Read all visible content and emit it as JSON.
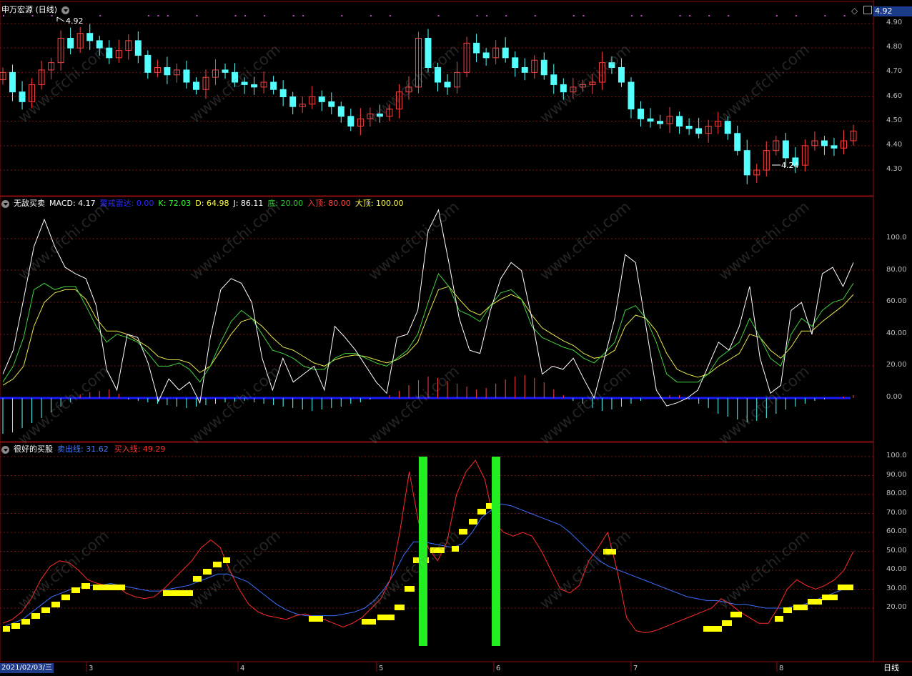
{
  "panel1": {
    "title": "申万宏源 (日线)",
    "price_box": "4.92",
    "high_marker": "4.92",
    "low_marker": "4.24",
    "axis": [
      "4.90",
      "4.80",
      "4.70",
      "4.60",
      "4.50",
      "4.40",
      "4.30"
    ]
  },
  "panel2": {
    "title": "无敌买卖",
    "items": [
      {
        "text": "MACD: 4.17",
        "color": "#ffffff"
      },
      {
        "text": "警戒雷达: 0.00",
        "color": "#2a2aff"
      },
      {
        "text": "K: 72.03",
        "color": "#33ff33"
      },
      {
        "text": "D: 64.98",
        "color": "#ffff44"
      },
      {
        "text": "J: 86.11",
        "color": "#ffffff"
      },
      {
        "text": "底: 20.00",
        "color": "#33cc33"
      },
      {
        "text": "入顶: 80.00",
        "color": "#ff4444"
      },
      {
        "text": "大顶: 100.00",
        "color": "#ffff44"
      }
    ],
    "axis": [
      "100.0",
      "80.00",
      "60.00",
      "40.00",
      "20.00",
      "0.00"
    ]
  },
  "panel3": {
    "title": "很好的买股",
    "items": [
      {
        "text": "卖出线: 31.62",
        "color": "#4477ff"
      },
      {
        "text": "买入线: 49.29",
        "color": "#ff3333"
      }
    ],
    "axis": [
      "100.0",
      "90.00",
      "80.00",
      "70.00",
      "60.00",
      "50.00",
      "40.00",
      "30.00",
      "20.00"
    ]
  },
  "bottom": {
    "date": "2021/02/03/三",
    "months": [
      "3",
      "4",
      "5",
      "6",
      "7",
      "8"
    ],
    "period": "日线"
  },
  "watermark": "www.cfchi.com",
  "chart_data": {
    "type": "line",
    "candles_close": [
      4.7,
      4.62,
      4.58,
      4.65,
      4.71,
      4.74,
      4.84,
      4.8,
      4.86,
      4.83,
      4.8,
      4.76,
      4.79,
      4.83,
      4.77,
      4.7,
      4.72,
      4.69,
      4.71,
      4.66,
      4.63,
      4.68,
      4.71,
      4.7,
      4.66,
      4.65,
      4.64,
      4.66,
      4.63,
      4.6,
      4.56,
      4.57,
      4.6,
      4.58,
      4.56,
      4.52,
      4.48,
      4.51,
      4.53,
      4.52,
      4.55,
      4.62,
      4.64,
      4.84,
      4.72,
      4.66,
      4.64,
      4.7,
      4.82,
      4.78,
      4.76,
      4.8,
      4.76,
      4.72,
      4.7,
      4.75,
      4.69,
      4.65,
      4.62,
      4.64,
      4.65,
      4.66,
      4.74,
      4.72,
      4.66,
      4.55,
      4.51,
      4.5,
      4.49,
      4.52,
      4.48,
      4.47,
      4.45,
      4.48,
      4.5,
      4.45,
      4.38,
      4.28,
      4.3,
      4.38,
      4.42,
      4.35,
      4.32,
      4.4,
      4.42,
      4.4,
      4.39,
      4.42,
      4.46
    ],
    "j_line": [
      15,
      30,
      62,
      95,
      112,
      95,
      82,
      78,
      75,
      58,
      18,
      5,
      40,
      38,
      22,
      -2,
      12,
      5,
      10,
      -3,
      38,
      68,
      75,
      72,
      60,
      25,
      5,
      25,
      10,
      15,
      20,
      5,
      45,
      38,
      30,
      20,
      10,
      3,
      38,
      40,
      55,
      105,
      118,
      85,
      50,
      30,
      28,
      55,
      75,
      85,
      80,
      50,
      15,
      20,
      18,
      25,
      12,
      0,
      25,
      50,
      90,
      85,
      45,
      5,
      -5,
      -3,
      0,
      5,
      20,
      35,
      30,
      45,
      70,
      25,
      3,
      8,
      55,
      60,
      40,
      78,
      82,
      70,
      85
    ],
    "k_line": [
      10,
      20,
      38,
      68,
      72,
      68,
      70,
      70,
      58,
      45,
      35,
      40,
      38,
      35,
      28,
      20,
      20,
      22,
      18,
      10,
      20,
      35,
      48,
      55,
      50,
      40,
      30,
      28,
      25,
      20,
      18,
      18,
      25,
      28,
      28,
      25,
      22,
      20,
      25,
      30,
      40,
      60,
      78,
      70,
      55,
      52,
      48,
      58,
      66,
      68,
      62,
      45,
      38,
      35,
      32,
      30,
      25,
      22,
      28,
      35,
      55,
      58,
      50,
      35,
      15,
      10,
      10,
      10,
      15,
      25,
      30,
      35,
      50,
      38,
      25,
      20,
      40,
      50,
      45,
      55,
      60,
      62,
      72
    ],
    "d_line": [
      8,
      12,
      20,
      45,
      60,
      66,
      68,
      68,
      62,
      50,
      42,
      42,
      40,
      36,
      32,
      26,
      24,
      24,
      22,
      16,
      20,
      30,
      40,
      48,
      50,
      45,
      38,
      32,
      30,
      26,
      22,
      20,
      24,
      26,
      27,
      26,
      24,
      22,
      24,
      28,
      35,
      52,
      68,
      70,
      62,
      55,
      52,
      58,
      62,
      65,
      62,
      52,
      44,
      40,
      36,
      33,
      28,
      25,
      26,
      30,
      45,
      52,
      50,
      42,
      28,
      18,
      15,
      13,
      15,
      20,
      24,
      28,
      40,
      38,
      30,
      25,
      32,
      42,
      42,
      48,
      53,
      58,
      65
    ]
  }
}
